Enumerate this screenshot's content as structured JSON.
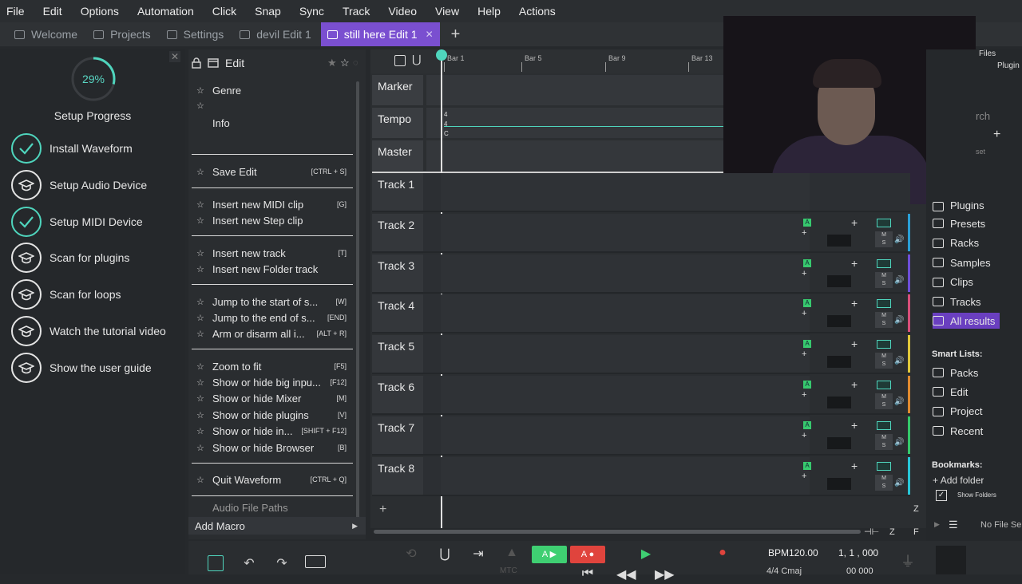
{
  "menu": [
    "File",
    "Edit",
    "Options",
    "Automation",
    "Click",
    "Snap",
    "Sync",
    "Track",
    "Video",
    "View",
    "Help",
    "Actions"
  ],
  "tabs": [
    {
      "label": "Welcome"
    },
    {
      "label": "Projects"
    },
    {
      "label": "Settings"
    },
    {
      "label": "devil Edit 1"
    },
    {
      "label": "still here Edit 1",
      "active": true
    }
  ],
  "setup": {
    "progress_label": "29%",
    "progress_value": 0.29,
    "title": "Setup Progress",
    "steps": [
      {
        "label": "Install Waveform",
        "done": true
      },
      {
        "label": "Setup Audio Device",
        "done": false
      },
      {
        "label": "Setup MIDI Device",
        "done": true
      },
      {
        "label": "Scan for plugins",
        "done": false
      },
      {
        "label": "Scan for loops",
        "done": false
      },
      {
        "label": "Watch the tutorial video",
        "done": false
      },
      {
        "label": "Show the user guide",
        "done": false
      }
    ]
  },
  "edit_panel": {
    "title": "Edit",
    "items": [
      {
        "label": "Genre",
        "kbd": ""
      },
      {
        "label": "Info",
        "kbd": ""
      },
      {
        "label": "Save Edit",
        "kbd": "[CTRL + S]"
      },
      {
        "label": "Insert new MIDI clip",
        "kbd": "[G]"
      },
      {
        "label": "Insert new Step clip",
        "kbd": ""
      },
      {
        "label": "Insert new track",
        "kbd": "[T]"
      },
      {
        "label": "Insert new Folder track",
        "kbd": ""
      },
      {
        "label": "Jump to the start of s...",
        "kbd": "[W]"
      },
      {
        "label": "Jump to the end of s...",
        "kbd": "[END]"
      },
      {
        "label": "Arm or disarm all i...",
        "kbd": "[ALT + R]"
      },
      {
        "label": "Zoom to fit",
        "kbd": "[F5]"
      },
      {
        "label": "Show or hide big inpu...",
        "kbd": "[F12]"
      },
      {
        "label": "Show or hide Mixer",
        "kbd": "[M]"
      },
      {
        "label": "Show or hide plugins",
        "kbd": "[V]"
      },
      {
        "label": "Show or hide in...",
        "kbd": "[SHIFT + F12]"
      },
      {
        "label": "Show or hide Browser",
        "kbd": "[B]"
      },
      {
        "label": "Quit Waveform",
        "kbd": "[CTRL + Q]"
      },
      {
        "label": "Audio File Paths",
        "kbd": ""
      }
    ],
    "add_macro": "Add Macro"
  },
  "ruler": {
    "bars": [
      "Bar 1",
      "Bar 5",
      "Bar 9",
      "Bar 13"
    ]
  },
  "special_rows": {
    "marker": "Marker",
    "tempo": "Tempo",
    "master": "Master",
    "tempo_sig": [
      "4",
      "4",
      "C"
    ]
  },
  "tracks": [
    {
      "name": "Track 1",
      "color": "#2fbf8f"
    },
    {
      "name": "Track 2",
      "color": "#2a9fd6"
    },
    {
      "name": "Track 3",
      "color": "#6d4fd8"
    },
    {
      "name": "Track 4",
      "color": "#d84f7a"
    },
    {
      "name": "Track 5",
      "color": "#e0c83a"
    },
    {
      "name": "Track 6",
      "color": "#e08a2f"
    },
    {
      "name": "Track 7",
      "color": "#34c96a"
    },
    {
      "name": "Track 8",
      "color": "#27c7d8"
    }
  ],
  "track_controls": {
    "arm": "A",
    "mute": "M",
    "solo": "S"
  },
  "browser": {
    "top_labels": [
      "Files",
      "Plugin",
      "rch",
      "set"
    ],
    "items": [
      {
        "label": "Plugins"
      },
      {
        "label": "Presets"
      },
      {
        "label": "Racks"
      },
      {
        "label": "Samples"
      },
      {
        "label": "Clips"
      },
      {
        "label": "Tracks"
      },
      {
        "label": "All results",
        "selected": true
      }
    ],
    "smart_lists_title": "Smart Lists:",
    "smart_lists": [
      "Packs",
      "Edit",
      "Project",
      "Recent"
    ],
    "bookmarks_title": "Bookmarks:",
    "add_folder": "Add folder",
    "show_folders": "Show Folders",
    "no_file": "No File Se"
  },
  "transport": {
    "bpm": "BPM120.00",
    "position": "1, 1 , 000",
    "sig": "4/4  Cmaj",
    "pos2": "00 000",
    "mtc": "MTC",
    "zoom_labels": [
      "Z",
      "F"
    ]
  },
  "colors": {
    "accent": "#7a4fd0",
    "teal": "#4fd5bd",
    "green": "#3fcf72",
    "red": "#e0443d"
  }
}
